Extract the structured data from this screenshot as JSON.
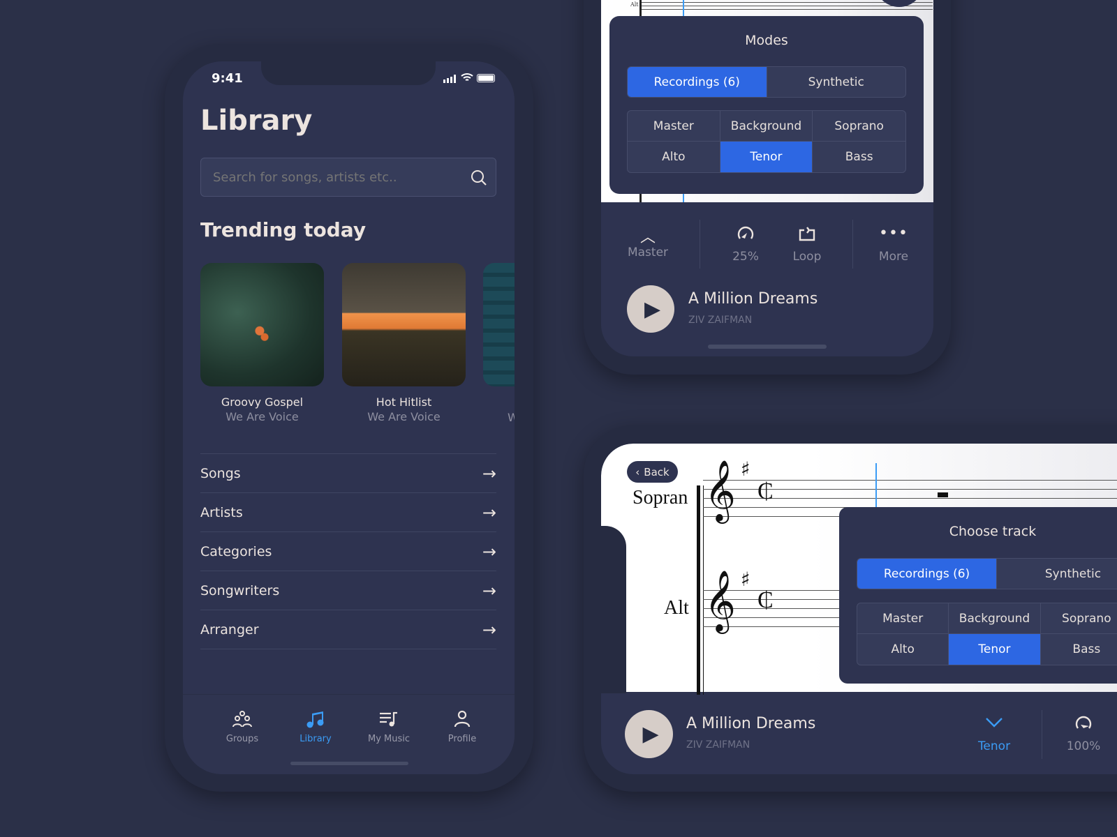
{
  "status": {
    "time": "9:41"
  },
  "library": {
    "title": "Library",
    "search_placeholder": "Search for songs, artists etc..",
    "trending_title": "Trending today",
    "cards": [
      {
        "title": "Groovy Gospel",
        "artist": "We Are Voice"
      },
      {
        "title": "Hot Hitlist",
        "artist": "We Are Voice"
      },
      {
        "title": "",
        "artist": "W"
      }
    ],
    "rows": [
      "Songs",
      "Artists",
      "Categories",
      "Songwriters",
      "Arranger"
    ],
    "nav": [
      {
        "label": "Groups",
        "icon": "groups-icon"
      },
      {
        "label": "Library",
        "icon": "music-note-icon",
        "active": true
      },
      {
        "label": "My Music",
        "icon": "playlist-icon"
      },
      {
        "label": "Profile",
        "icon": "person-icon"
      }
    ]
  },
  "modes_panel": {
    "title": "Modes",
    "tabs": [
      "Recordings (6)",
      "Synthetic"
    ],
    "tracks": [
      "Master",
      "Background",
      "Soprano",
      "Alto",
      "Tenor",
      "Bass"
    ],
    "selected_tab": "Recordings (6)",
    "selected_track": "Tenor",
    "staff_label": "Alt"
  },
  "toolbar": {
    "master": "Master",
    "speed": "25%",
    "loop": "Loop",
    "more": "More"
  },
  "player": {
    "song": "A Million Dreams",
    "artist": "ZIV ZAIFMAN"
  },
  "landscape": {
    "back": "Back",
    "staff_labels": [
      "Sopran",
      "Alt"
    ],
    "panel_title": "Choose track",
    "tabs": [
      "Recordings (6)",
      "Synthetic"
    ],
    "tracks": [
      "Master",
      "Background",
      "Soprano",
      "Alto",
      "Tenor",
      "Bass"
    ],
    "song": "A Million Dreams",
    "artist": "ZIV ZAIFMAN",
    "track_label": "Tenor",
    "speed": "100%"
  },
  "colors": {
    "background": "#2b3048",
    "accent": "#2d67e3",
    "active_nav": "#3b9cf5"
  }
}
